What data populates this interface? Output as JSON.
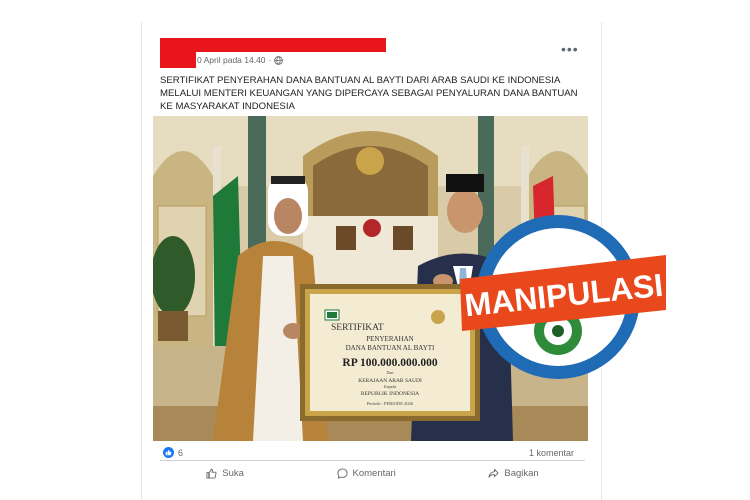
{
  "post": {
    "timestamp": "0 April pada 14.40",
    "more_label": "•••",
    "caption": "SERTIFIKAT PENYERAHAN DANA BANTUAN AL BAYTI DARI ARAB SAUDI KE INDONESIA MELALUI MENTERI KEUANGAN YANG DIPERCAYA SEBAGAI PENYALURAN DANA BANTUAN KE MASYARAKAT INDONESIA"
  },
  "certificate": {
    "title": "SERTIFIKAT",
    "line1": "PENYERAHAN",
    "line2": "DANA BANTUAN AL BAYTI",
    "amount": "RP 100.000.000.000",
    "from_label": "Dari",
    "from": "KERAJAAN ARAB SAUDI",
    "to_label": "Kepada",
    "to": "REPUBLIK INDONESIA",
    "period": "Periode : PERIODE 2026"
  },
  "stamp": {
    "label": "MANIPULASI",
    "colors": {
      "ring": "#1f6bb5",
      "banner": "#e8481c",
      "seal": "#2e8b3a"
    }
  },
  "engagement": {
    "reactions": "6",
    "comments": "1 komentar"
  },
  "actions": {
    "like": "Suka",
    "comment": "Komentari",
    "share": "Bagikan"
  }
}
